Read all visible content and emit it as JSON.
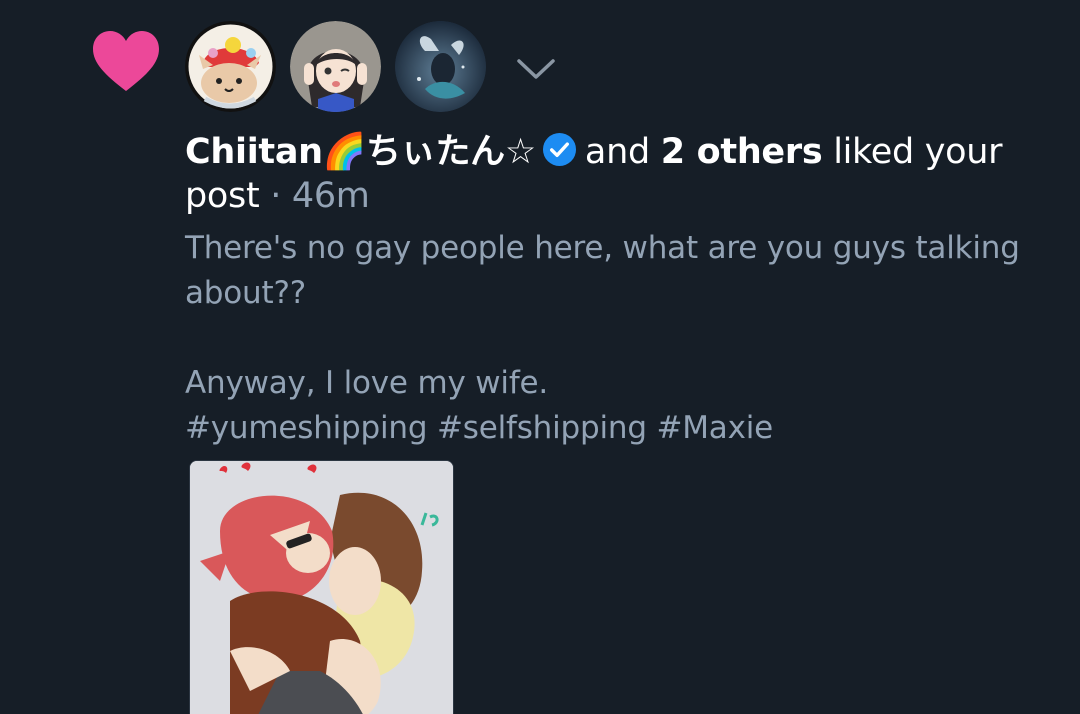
{
  "notification": {
    "type_icon": "heart-icon",
    "heart_color": "#ec4899",
    "avatars": [
      {
        "icon": "cat-avatar"
      },
      {
        "icon": "anime-girl-avatar"
      },
      {
        "icon": "fantasy-art-avatar"
      }
    ],
    "expand_icon": "chevron-down-icon",
    "actor_name": "Chiitan🌈ちぃたん☆",
    "verified_icon": "verified-check-icon",
    "verified_color": "#1d8cf2",
    "connector": "and",
    "others": "2 others",
    "action": "liked your post",
    "separator": "·",
    "time": "46m"
  },
  "post": {
    "text": "There's no gay people here, what are you guys talking about??\n\nAnyway, I love my wife.\n#yumeshipping #selfshipping #Maxie",
    "image_icon": "fan-art-image"
  },
  "colors": {
    "background": "#161e27",
    "primary_text": "#ffffff",
    "secondary_text": "#93a3b5"
  }
}
